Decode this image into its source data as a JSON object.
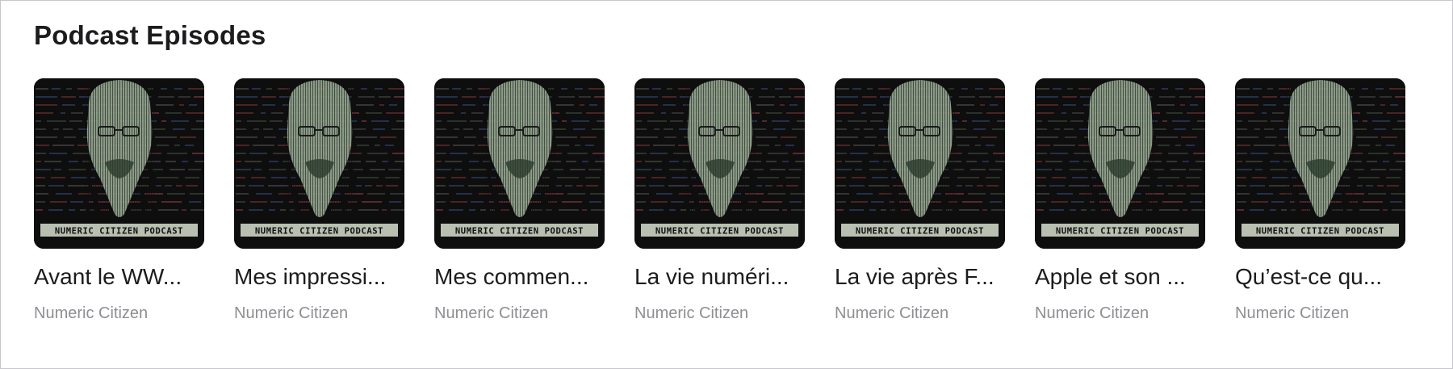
{
  "section": {
    "title": "Podcast Episodes"
  },
  "episodes": [
    {
      "title": "Avant le WW...",
      "author": "Numeric Citizen",
      "cover_text": "NUMERIC CITIZEN PODCAST"
    },
    {
      "title": "Mes impressi...",
      "author": "Numeric Citizen",
      "cover_text": "NUMERIC CITIZEN PODCAST"
    },
    {
      "title": "Mes commen...",
      "author": "Numeric Citizen",
      "cover_text": "NUMERIC CITIZEN PODCAST"
    },
    {
      "title": "La vie numéri...",
      "author": "Numeric Citizen",
      "cover_text": "NUMERIC CITIZEN PODCAST"
    },
    {
      "title": "La vie après F...",
      "author": "Numeric Citizen",
      "cover_text": "NUMERIC CITIZEN PODCAST"
    },
    {
      "title": "Apple et son ...",
      "author": "Numeric Citizen",
      "cover_text": "NUMERIC CITIZEN PODCAST"
    },
    {
      "title": "Qu’est-ce qu...",
      "author": "Numeric Citizen",
      "cover_text": "NUMERIC CITIZEN PODCAST"
    }
  ],
  "colors": {
    "artwork_background": "#0e0e0e",
    "portrait_tint": "#9fb39a",
    "banner_background": "#b9c0b2",
    "title_text": "#1c1c1e",
    "secondary_text": "#8e8e93"
  }
}
